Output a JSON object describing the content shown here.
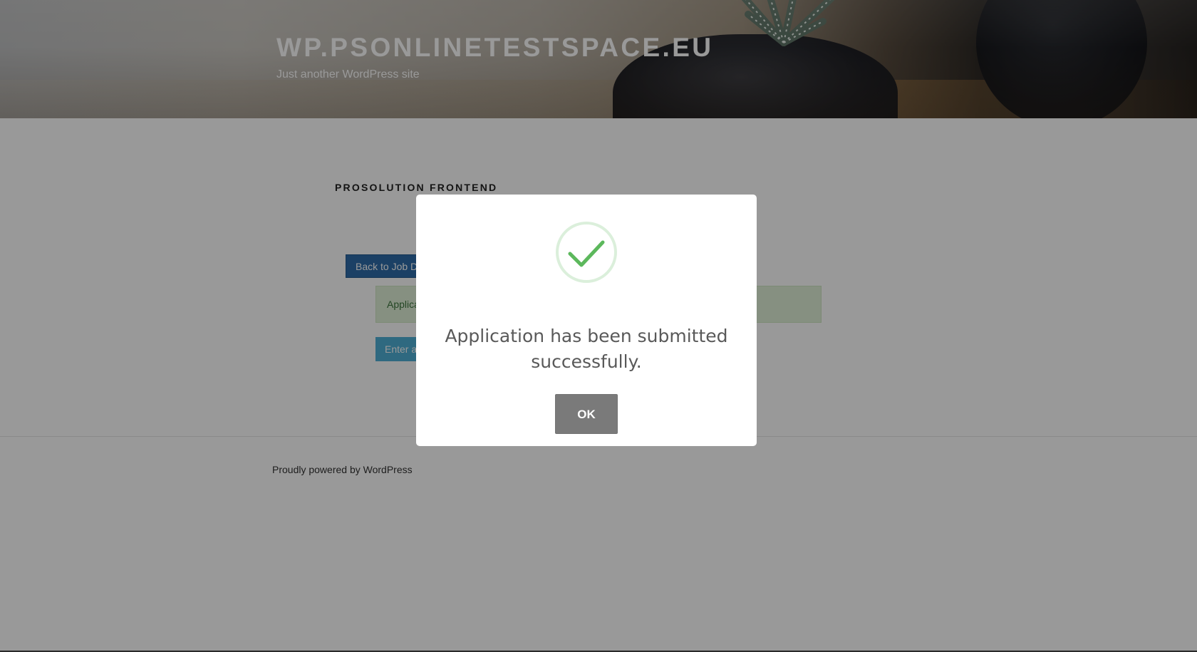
{
  "header": {
    "site_title": "WP.PSONLINETESTSPACE.EU",
    "tagline": "Just another WordPress site"
  },
  "content": {
    "page_title": "PROSOLUTION FRONTEND",
    "back_button_label": "Back to Job D",
    "alert_text": "Applica",
    "enter_button_label": "Enter a"
  },
  "footer": {
    "credit": "Proudly powered by WordPress"
  },
  "modal": {
    "icon": "checkmark-success-icon",
    "message": "Application has been submitted successfully.",
    "ok_label": "OK"
  },
  "colors": {
    "success_green": "#5cb85c",
    "ok_button": "#7a7a7a",
    "back_button": "#2e6ca8",
    "alert_bg": "#dff0d8",
    "enter_button": "#4fb0d6"
  }
}
